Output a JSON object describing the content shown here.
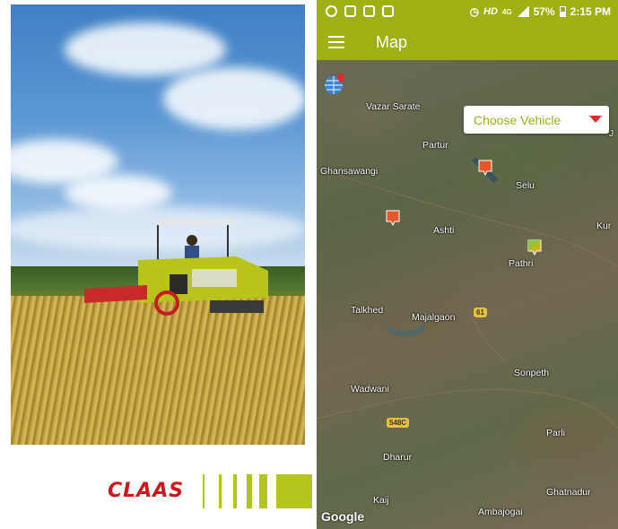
{
  "splash": {
    "brand_name": "CLAAS",
    "brand_color": "#d0161b",
    "accent_color": "#b3c41c"
  },
  "status_bar": {
    "hd": "HD",
    "network": "4G",
    "battery": "57%",
    "time": "2:15 PM",
    "left_icons": [
      "data-saver-icon",
      "image-icon",
      "mail-icon",
      "analytics-icon"
    ],
    "alarm_icon": "alarm-icon"
  },
  "app_bar": {
    "title": "Map",
    "menu_icon": "menu-icon",
    "color": "#9eb012"
  },
  "map": {
    "vehicle_select": {
      "label": "Choose Vehicle",
      "arrow_icon": "dropdown-arrow-icon"
    },
    "globe_icon": "globe-location-icon",
    "attribution": "Google",
    "places": [
      "Vazar Sarate",
      "Partur",
      "Ghansawangi",
      "Selu",
      "Ashti",
      "Kur",
      "Pathri",
      "Talkhed",
      "Majalgaon",
      "Sonpeth",
      "Wadwani",
      "Parli",
      "Dharur",
      "Ghatnadur",
      "Kaij",
      "Ambajogai",
      "J"
    ],
    "road_signs": [
      "61",
      "548C"
    ],
    "markers": [
      {
        "name": "vehicle-marker-orange-1",
        "color": "#e4572a"
      },
      {
        "name": "vehicle-marker-orange-2",
        "color": "#e4572a"
      },
      {
        "name": "vehicle-marker-mixed",
        "color": "#c8b21f"
      }
    ]
  }
}
